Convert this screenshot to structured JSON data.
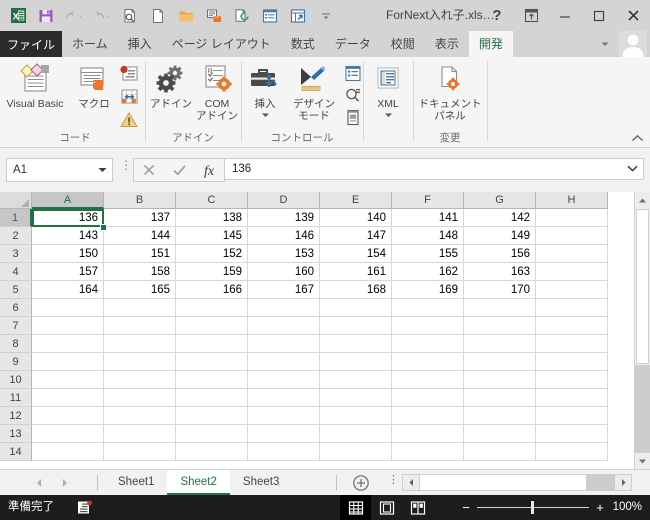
{
  "window": {
    "title": "ForNext入れ子.xls…",
    "quick_access": [
      {
        "name": "excel-logo-icon",
        "label": "Excel"
      },
      {
        "name": "save-icon",
        "label": "上書き保存"
      },
      {
        "name": "undo-icon",
        "label": "元に戻す"
      },
      {
        "name": "redo-icon",
        "label": "やり直し"
      },
      {
        "name": "print-preview-icon",
        "label": "印刷プレビューと印刷"
      },
      {
        "name": "new-file-icon",
        "label": "新規作成"
      },
      {
        "name": "open-folder-icon",
        "label": "開く"
      },
      {
        "name": "quick-print-icon",
        "label": "クイック印刷"
      },
      {
        "name": "refresh-icon",
        "label": "更新"
      },
      {
        "name": "form-icon",
        "label": "フォーム"
      },
      {
        "name": "sheet-link-icon",
        "label": "シート"
      },
      {
        "name": "customize-qat-icon",
        "label": "クイック アクセス ツール バーのユーザー設定"
      }
    ],
    "buttons": {
      "help": "?",
      "ribbon_display": "リボンの表示オプション",
      "minimize": "最小化",
      "maximize": "最大化",
      "close": "閉じる"
    }
  },
  "ribbon": {
    "file_tab": "ファイル",
    "tabs": [
      {
        "label": "ホーム",
        "active": false
      },
      {
        "label": "挿入",
        "active": false
      },
      {
        "label": "ページ レイアウト",
        "active": false
      },
      {
        "label": "数式",
        "active": false
      },
      {
        "label": "データ",
        "active": false
      },
      {
        "label": "校閲",
        "active": false
      },
      {
        "label": "表示",
        "active": false
      },
      {
        "label": "開発",
        "active": true
      }
    ],
    "groups": [
      {
        "label": "コード"
      },
      {
        "label": "アドイン"
      },
      {
        "label": "コントロール"
      },
      {
        "label": ""
      },
      {
        "label": "変更"
      }
    ],
    "commands": {
      "visual_basic": "Visual Basic",
      "macro": "マクロ",
      "record_macro": "マクロの記録",
      "use_relative_references": "相対参照で記録",
      "macro_security": "マクロのセキュリティ",
      "addins": "アドイン",
      "com_addins_line1": "COM",
      "com_addins_line2": "アドイン",
      "insert_control": "挿入",
      "design_mode_line1": "デザイン",
      "design_mode_line2": "モード",
      "properties": "プロパティ",
      "view_code": "コードの表示",
      "run_dialog": "ダイアログの実行",
      "xml": "XML",
      "document_panel_line1": "ドキュメント",
      "document_panel_line2": "パネル"
    },
    "collapse_label": "リボンを折りたたむ"
  },
  "formula_bar": {
    "name_box_value": "A1",
    "cancel_label": "キャンセル",
    "enter_label": "入力",
    "function_label": "関数の挿入",
    "formula_value": "136",
    "expand_label": "数式バーの展開"
  },
  "grid": {
    "columns": [
      "A",
      "B",
      "C",
      "D",
      "E",
      "F",
      "G",
      "H"
    ],
    "rows": [
      1,
      2,
      3,
      4,
      5,
      6,
      7,
      8,
      9,
      10,
      11,
      12,
      13,
      14
    ],
    "selected_cell": "A1",
    "selected_column": "A",
    "selected_row": 1,
    "data": [
      [
        "136",
        "137",
        "138",
        "139",
        "140",
        "141",
        "142",
        ""
      ],
      [
        "143",
        "144",
        "145",
        "146",
        "147",
        "148",
        "149",
        ""
      ],
      [
        "150",
        "151",
        "152",
        "153",
        "154",
        "155",
        "156",
        ""
      ],
      [
        "157",
        "158",
        "159",
        "160",
        "161",
        "162",
        "163",
        ""
      ],
      [
        "164",
        "165",
        "166",
        "167",
        "168",
        "169",
        "170",
        ""
      ],
      [
        "",
        "",
        "",
        "",
        "",
        "",
        "",
        ""
      ],
      [
        "",
        "",
        "",
        "",
        "",
        "",
        "",
        ""
      ],
      [
        "",
        "",
        "",
        "",
        "",
        "",
        "",
        ""
      ],
      [
        "",
        "",
        "",
        "",
        "",
        "",
        "",
        ""
      ],
      [
        "",
        "",
        "",
        "",
        "",
        "",
        "",
        ""
      ],
      [
        "",
        "",
        "",
        "",
        "",
        "",
        "",
        ""
      ],
      [
        "",
        "",
        "",
        "",
        "",
        "",
        "",
        ""
      ],
      [
        "",
        "",
        "",
        "",
        "",
        "",
        "",
        ""
      ],
      [
        "",
        "",
        "",
        "",
        "",
        "",
        "",
        ""
      ]
    ]
  },
  "sheet_bar": {
    "nav_first": "先頭シート",
    "nav_prev": "前のシート",
    "tabs": [
      {
        "label": "Sheet1",
        "active": false
      },
      {
        "label": "Sheet2",
        "active": true
      },
      {
        "label": "Sheet3",
        "active": false
      }
    ],
    "add_sheet": "新しいシート",
    "all_sheets": "すべてのシート"
  },
  "status_bar": {
    "state": "準備完了",
    "macro_record": "マクロの記録",
    "views": [
      {
        "name": "normal-view-icon",
        "label": "標準",
        "active": true
      },
      {
        "name": "page-layout-view-icon",
        "label": "ページ レイアウト",
        "active": false
      },
      {
        "name": "page-break-view-icon",
        "label": "改ページ プレビュー",
        "active": false
      }
    ],
    "zoom_out": "−",
    "zoom_in": "+",
    "zoom_level": "100%"
  },
  "colors": {
    "accent_green": "#217346",
    "titlebar": "#d4d4d4",
    "ribbon": "#f5f5f5",
    "status_bar": "#1d1d1d",
    "orange": "#e8762c"
  }
}
